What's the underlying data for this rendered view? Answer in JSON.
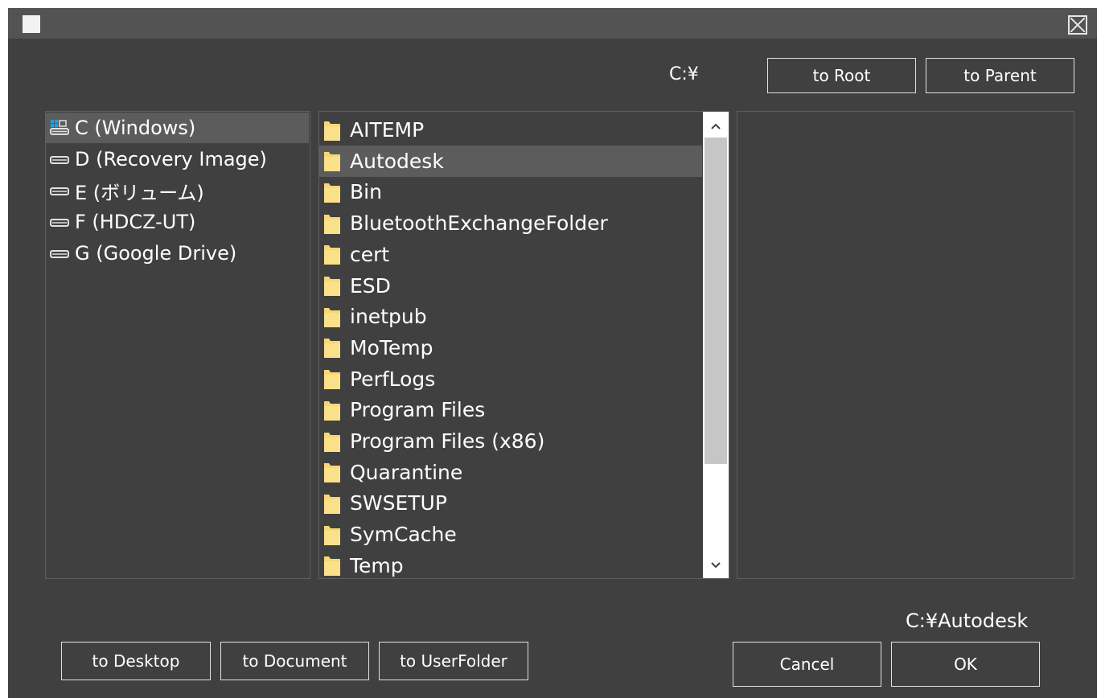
{
  "window": {
    "close_icon": "close-box-icon"
  },
  "current_path": "C:¥",
  "selected_path": "C:¥Autodesk",
  "top_buttons": {
    "to_root": "to Root",
    "to_parent": "to Parent"
  },
  "drives": [
    {
      "label": "C (Windows)",
      "icon": "system-drive-icon",
      "selected": true
    },
    {
      "label": "D (Recovery Image)",
      "icon": "drive-icon",
      "selected": false
    },
    {
      "label": "E (ボリューム)",
      "icon": "drive-icon",
      "selected": false
    },
    {
      "label": "F (HDCZ-UT)",
      "icon": "drive-icon",
      "selected": false
    },
    {
      "label": "G (Google Drive)",
      "icon": "drive-icon",
      "selected": false
    }
  ],
  "folders": [
    {
      "label": "AITEMP",
      "selected": false
    },
    {
      "label": "Autodesk",
      "selected": true
    },
    {
      "label": "Bin",
      "selected": false
    },
    {
      "label": "BluetoothExchangeFolder",
      "selected": false
    },
    {
      "label": "cert",
      "selected": false
    },
    {
      "label": "ESD",
      "selected": false
    },
    {
      "label": "inetpub",
      "selected": false
    },
    {
      "label": "MoTemp",
      "selected": false
    },
    {
      "label": "PerfLogs",
      "selected": false
    },
    {
      "label": "Program Files",
      "selected": false
    },
    {
      "label": "Program Files (x86)",
      "selected": false
    },
    {
      "label": "Quarantine",
      "selected": false
    },
    {
      "label": "SWSETUP",
      "selected": false
    },
    {
      "label": "SymCache",
      "selected": false
    },
    {
      "label": "Temp",
      "selected": false
    }
  ],
  "bottom_buttons": {
    "to_desktop": "to Desktop",
    "to_document": "to Document",
    "to_userfolder": "to UserFolder"
  },
  "dialog_buttons": {
    "cancel": "Cancel",
    "ok": "OK"
  },
  "colors": {
    "background": "#404040",
    "titlebar": "#535353",
    "selection": "#5c5c5c",
    "folder": "#f7d774",
    "drive_accent": "#1ba1e2"
  }
}
